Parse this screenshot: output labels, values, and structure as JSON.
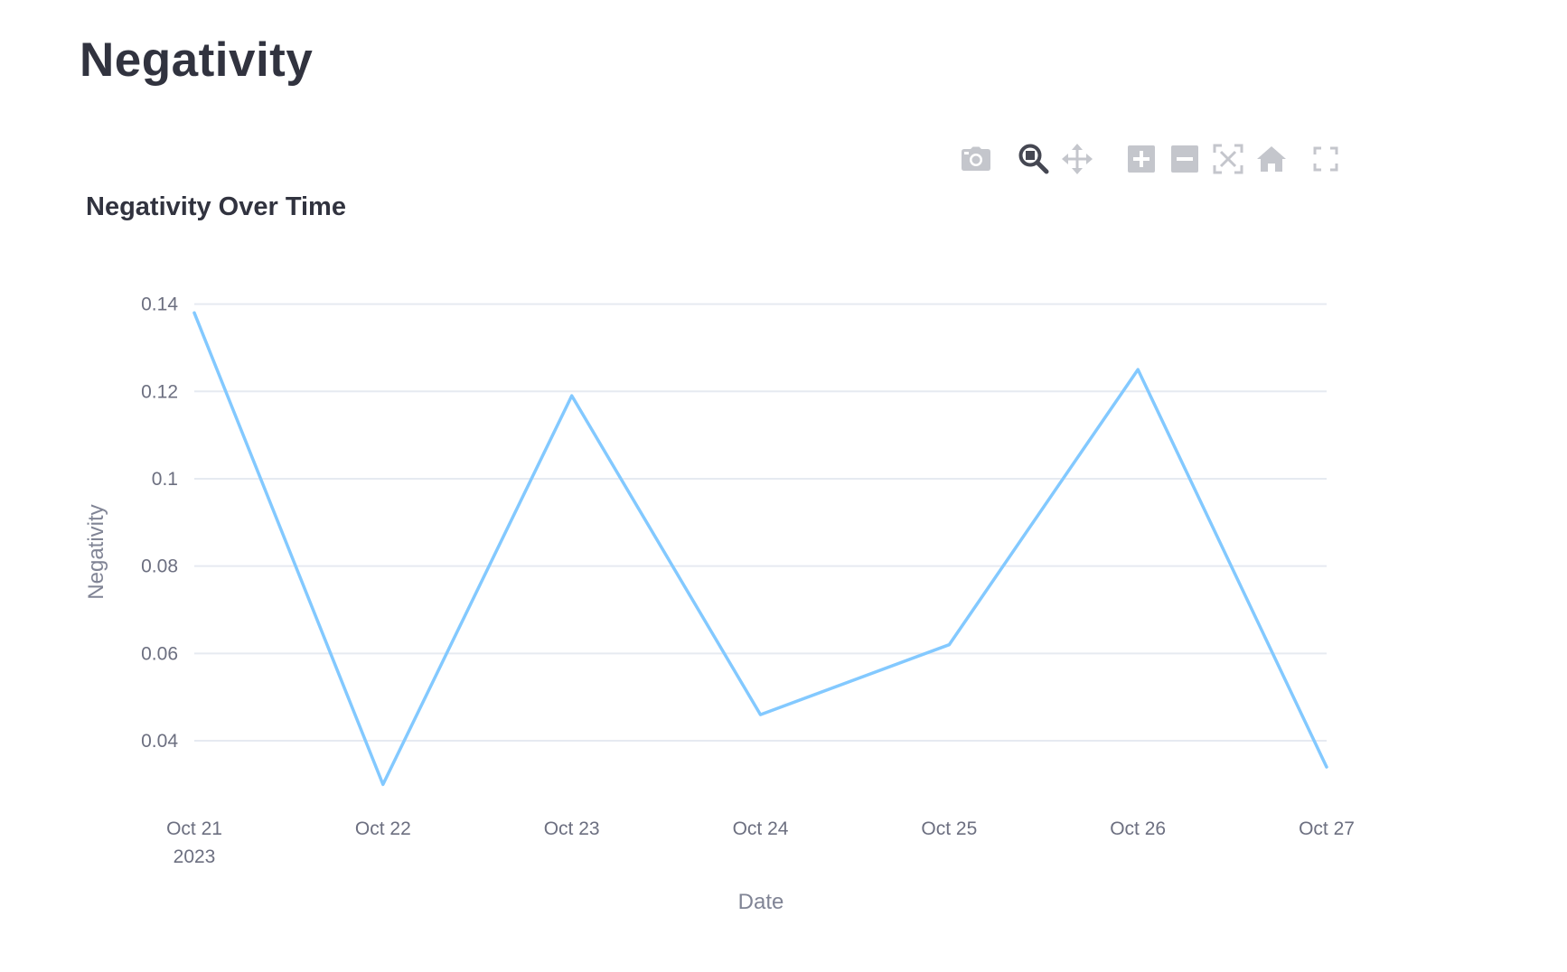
{
  "page": {
    "title": "Negativity"
  },
  "modebar": {
    "buttons": [
      {
        "name": "camera-icon",
        "label": "Download plot as a png"
      },
      {
        "name": "zoom-icon",
        "label": "Zoom",
        "active": true
      },
      {
        "name": "pan-icon",
        "label": "Pan"
      },
      {
        "name": "zoom-in-icon",
        "label": "Zoom in"
      },
      {
        "name": "zoom-out-icon",
        "label": "Zoom out"
      },
      {
        "name": "autoscale-icon",
        "label": "Autoscale"
      },
      {
        "name": "home-icon",
        "label": "Reset axes"
      },
      {
        "name": "fullscreen-icon",
        "label": "View fullscreen"
      }
    ]
  },
  "chart_data": {
    "type": "line",
    "title": "Negativity Over Time",
    "xlabel": "Date",
    "ylabel": "Negativity",
    "x": [
      "2023-10-21",
      "2023-10-22",
      "2023-10-23",
      "2023-10-24",
      "2023-10-25",
      "2023-10-26",
      "2023-10-27"
    ],
    "x_tick_labels": [
      "Oct 21",
      "Oct 22",
      "Oct 23",
      "Oct 24",
      "Oct 25",
      "Oct 26",
      "Oct 27"
    ],
    "x_tick_sublabel": "2023",
    "series": [
      {
        "values": [
          0.138,
          0.03,
          0.119,
          0.046,
          0.062,
          0.125,
          0.034
        ],
        "color": "#83c9ff"
      }
    ],
    "y_ticks": [
      0.04,
      0.06,
      0.08,
      0.1,
      0.12,
      0.14
    ],
    "y_tick_labels": [
      "0.04",
      "0.06",
      "0.08",
      "0.1",
      "0.12",
      "0.14"
    ],
    "ylim": [
      0.0245,
      0.1455
    ],
    "grid": true,
    "colors": {
      "grid": "#e6eaf1",
      "tick_text": "#6c6f80",
      "axis_title": "#808495",
      "title": "#31333f"
    }
  }
}
